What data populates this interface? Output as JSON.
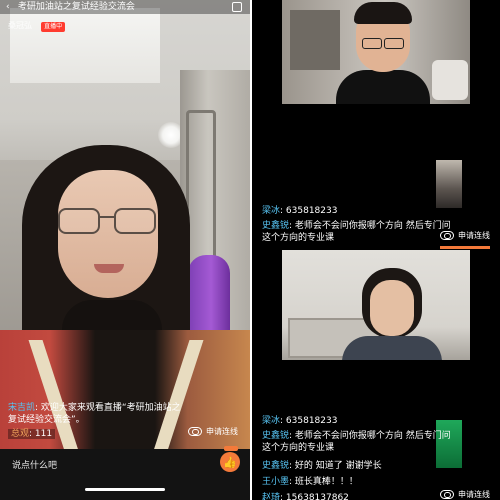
{
  "left": {
    "header": {
      "title": "考研加油站之复试经验交流会",
      "host_name": "桑冠弘",
      "host_badge": "直播中"
    },
    "comments": [
      {
        "user": "宋吉凯",
        "text": "欢迎大家来观看直播“考研加油站之复试经验交流会”。"
      },
      {
        "user": "总观",
        "text": "111"
      }
    ],
    "connect_label": "申请连线",
    "comment_placeholder": "说点什么吧",
    "like_icon": "thumbs-up-icon",
    "colors": {
      "accent": "#f47a3a",
      "name": "#57c3f2"
    }
  },
  "right": {
    "top_section": {
      "comments": [
        {
          "user": "梁冰",
          "text": "635818233"
        },
        {
          "user": "史鑫锐",
          "text": "老师会不会问你报哪个方向 然后专门问这个方向的专业课"
        }
      ],
      "connect_label": "申请连线"
    },
    "bottom_section": {
      "comments": [
        {
          "user": "梁冰",
          "text": "635818233"
        },
        {
          "user": "史鑫锐",
          "text": "老师会不会问你报哪个方向 然后专门问这个方向的专业课"
        },
        {
          "user": "史鑫锐",
          "text": "好的 知道了 谢谢学长"
        },
        {
          "user": "王小墨",
          "text": "班长真棒！！！"
        },
        {
          "user": "赵琦",
          "text": "15638137862"
        }
      ],
      "connect_label": "申请连线"
    }
  }
}
